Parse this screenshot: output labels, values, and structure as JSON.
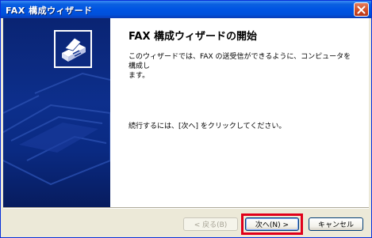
{
  "window": {
    "title": "FAX 構成ウィザード",
    "close_icon": "close-icon"
  },
  "side": {
    "logo_icon": "fax-machine-icon"
  },
  "main": {
    "heading": "FAX 構成ウィザードの開始",
    "intro_line1": "このウィザードでは、FAX の送受信ができるように、コンピュータを構成し",
    "intro_line2": "ます。",
    "continue_text": "続行するには、[次へ] をクリックしてください。"
  },
  "buttons": {
    "back_label": "< 戻る(B)",
    "next_label": "次へ(N) >",
    "cancel_label": "キャンセル",
    "highlight_color": "#e0001a"
  }
}
